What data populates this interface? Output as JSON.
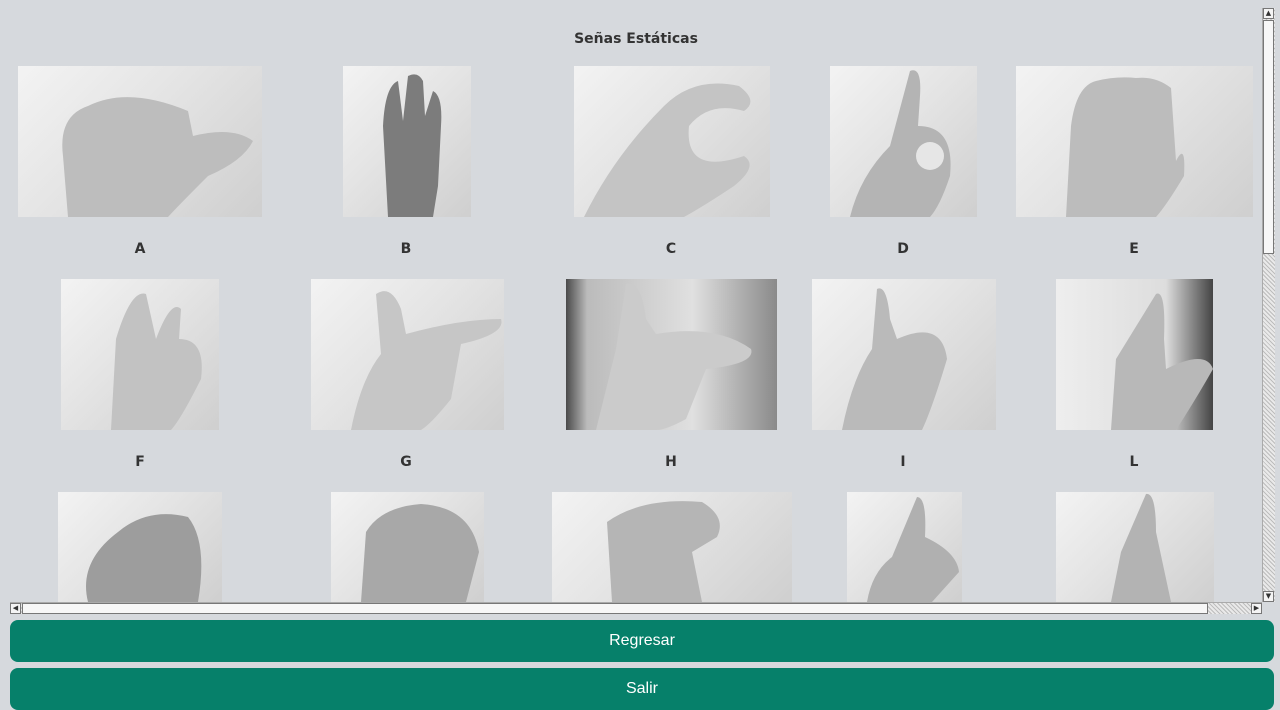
{
  "title": "Señas Estáticas",
  "signs": {
    "row1": [
      {
        "label": "A",
        "image_icon": "hand-sign-a-photo"
      },
      {
        "label": "B",
        "image_icon": "hand-sign-b-photo"
      },
      {
        "label": "C",
        "image_icon": "hand-sign-c-photo"
      },
      {
        "label": "D",
        "image_icon": "hand-sign-d-photo"
      },
      {
        "label": "E",
        "image_icon": "hand-sign-e-photo"
      }
    ],
    "row2": [
      {
        "label": "F",
        "image_icon": "hand-sign-f-photo"
      },
      {
        "label": "G",
        "image_icon": "hand-sign-g-photo"
      },
      {
        "label": "H",
        "image_icon": "hand-sign-h-photo"
      },
      {
        "label": "I",
        "image_icon": "hand-sign-i-photo"
      },
      {
        "label": "L",
        "image_icon": "hand-sign-l-photo"
      }
    ],
    "row3": [
      {
        "image_icon": "hand-sign-photo"
      },
      {
        "image_icon": "hand-sign-photo"
      },
      {
        "image_icon": "hand-sign-photo"
      },
      {
        "image_icon": "hand-sign-photo"
      },
      {
        "image_icon": "hand-sign-photo"
      }
    ]
  },
  "buttons": {
    "back_label": "Regresar",
    "exit_label": "Salir"
  },
  "colors": {
    "background": "#d6d9dd",
    "button": "#06806a",
    "button_text": "#ffffff"
  }
}
